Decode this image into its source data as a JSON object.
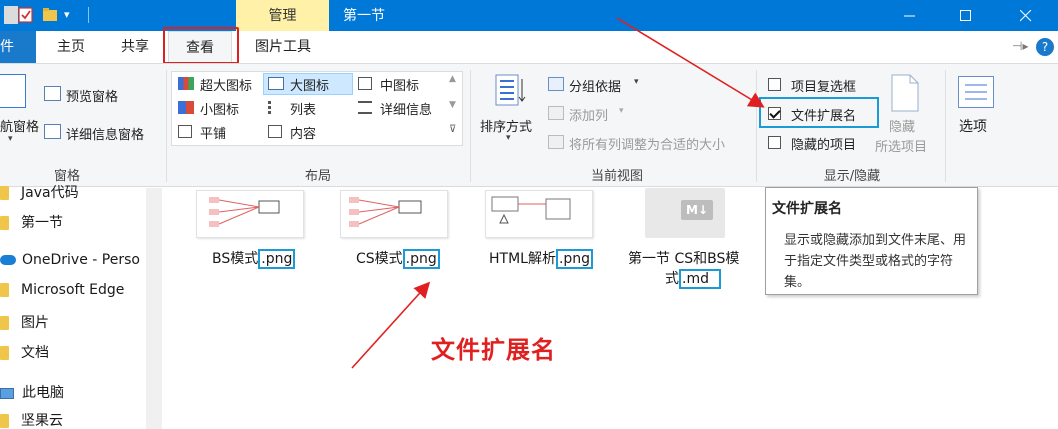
{
  "titlebar": {
    "context_tab": "管理",
    "window_title": "第一节",
    "minimize_icon": "minimize-icon",
    "maximize_icon": "maximize-icon",
    "close_icon": "close-icon"
  },
  "tabs": {
    "file": "文件",
    "home": "主页",
    "share": "共享",
    "view": "查看",
    "picture_tools": "图片工具"
  },
  "ribbon": {
    "panes": {
      "preview": "预览窗格",
      "details": "详细信息窗格",
      "nav_partial": "航窗格",
      "group": "窗格"
    },
    "layout": {
      "extra_large": "超大图标",
      "large": "大图标",
      "medium": "中图标",
      "small": "小图标",
      "list": "列表",
      "details": "详细信息",
      "tiles": "平铺",
      "content": "内容",
      "group": "布局"
    },
    "current_view": {
      "sort": "排序方式",
      "group_by": "分组依据",
      "add_column": "添加列",
      "fit_columns": "将所有列调整为合适的大小",
      "group": "当前视图"
    },
    "show_hide": {
      "item_checkboxes": "项目复选框",
      "file_extensions": "文件扩展名",
      "hidden_items": "隐藏的项目",
      "hide_selected_line1": "隐藏",
      "hide_selected_line2": "所选项目",
      "group": "显示/隐藏",
      "item_checkboxes_checked": false,
      "file_extensions_checked": true,
      "hidden_items_checked": false
    },
    "options": "选项"
  },
  "nav": {
    "java": "Java代码",
    "section1": "第一节",
    "onedrive": "OneDrive - Perso",
    "edge": "Microsoft Edge",
    "pictures": "图片",
    "documents": "文档",
    "this_pc": "此电脑",
    "jianguoyun": "坚果云"
  },
  "files": [
    {
      "base": "BS模式",
      "ext": ".png"
    },
    {
      "base": "CS模式",
      "ext": ".png"
    },
    {
      "base": "HTML解析",
      "ext": ".png"
    },
    {
      "base_line1": "第一节 CS和BS模",
      "base_line2": "式",
      "ext": ".md",
      "badge": "M↓"
    }
  ],
  "tooltip": {
    "title": "文件扩展名",
    "body": "显示或隐藏添加到文件末尾、用于指定文件类型或格式的字符集。"
  },
  "annotation": "文件扩展名",
  "colors": {
    "accent": "#0078d7",
    "annotation_red": "#e02020",
    "highlight_blue": "#1c9ad6",
    "manage_tab": "#fff2a8"
  }
}
